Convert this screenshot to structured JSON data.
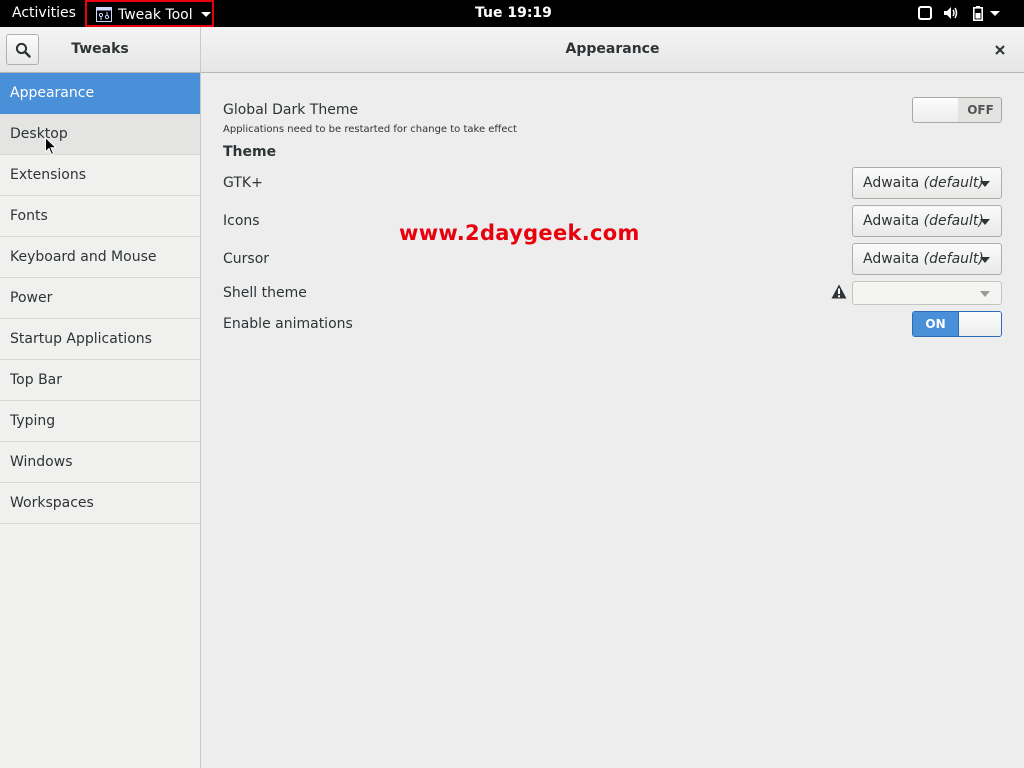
{
  "topbar": {
    "activities": "Activities",
    "app_name": "Tweak Tool",
    "clock": "Tue 19:19",
    "icons": [
      "window-icon",
      "volume-icon",
      "battery-icon",
      "chevron-down-icon"
    ]
  },
  "header": {
    "sidebar_title": "Tweaks",
    "page_title": "Appearance",
    "search_icon": "search-icon",
    "close_icon": "close-icon"
  },
  "sidebar": {
    "items": [
      {
        "label": "Appearance",
        "selected": true
      },
      {
        "label": "Desktop"
      },
      {
        "label": "Extensions"
      },
      {
        "label": "Fonts"
      },
      {
        "label": "Keyboard and Mouse"
      },
      {
        "label": "Power"
      },
      {
        "label": "Startup Applications"
      },
      {
        "label": "Top Bar"
      },
      {
        "label": "Typing"
      },
      {
        "label": "Windows"
      },
      {
        "label": "Workspaces"
      }
    ]
  },
  "content": {
    "dark_theme": {
      "label": "Global Dark Theme",
      "note": "Applications need to be restarted for change to take effect",
      "state": "OFF"
    },
    "theme_heading": "Theme",
    "gtk": {
      "label": "GTK+",
      "value_name": "Adwaita",
      "value_suffix": "(default)"
    },
    "icons": {
      "label": "Icons",
      "value_name": "Adwaita",
      "value_suffix": "(default)"
    },
    "cursor": {
      "label": "Cursor",
      "value_name": "Adwaita",
      "value_suffix": "(default)"
    },
    "shell_theme": {
      "label": "Shell theme",
      "value": ""
    },
    "animations": {
      "label": "Enable animations",
      "state": "ON"
    }
  },
  "watermark": "www.2daygeek.com",
  "colors": {
    "accent": "#4a90d9",
    "topbar_bg": "#000000",
    "highlight_border": "#e8000d",
    "watermark": "#e8000d"
  }
}
